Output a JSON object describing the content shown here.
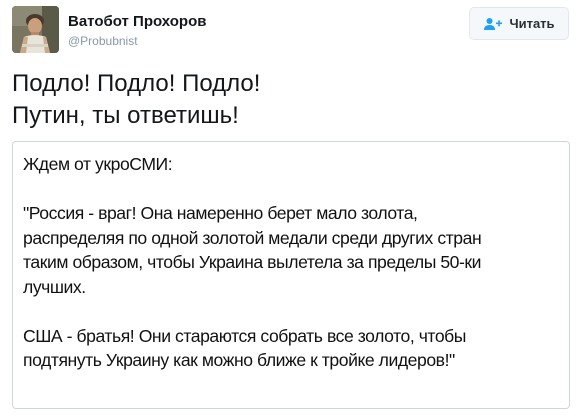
{
  "user": {
    "display_name": "Ватобот Прохоров",
    "handle": "@Probubnist"
  },
  "follow_button": {
    "label": "Читать",
    "icon": "follow-person-plus-icon"
  },
  "tweet": {
    "lines": [
      "Подло! Подло! Подло!",
      "Путин, ты ответишь!"
    ]
  },
  "image_text": {
    "heading": "Ждем от укроСМИ:",
    "paragraph1": [
      "\"Россия - враг! Она намеренно берет мало золота,",
      "распределяя по одной золотой медали среди других стран",
      "таким образом, чтобы Украина вылетела за пределы 50-ки",
      "лучших."
    ],
    "paragraph2": [
      "США - братья! Они стараются собрать все золото, чтобы",
      "подтянуть Украину как можно ближе к тройке лидеров!\""
    ]
  },
  "colors": {
    "name": "#14171a",
    "handle": "#8899a6",
    "follow_icon": "#1da1f2",
    "button_border": "#e1e8ed"
  }
}
